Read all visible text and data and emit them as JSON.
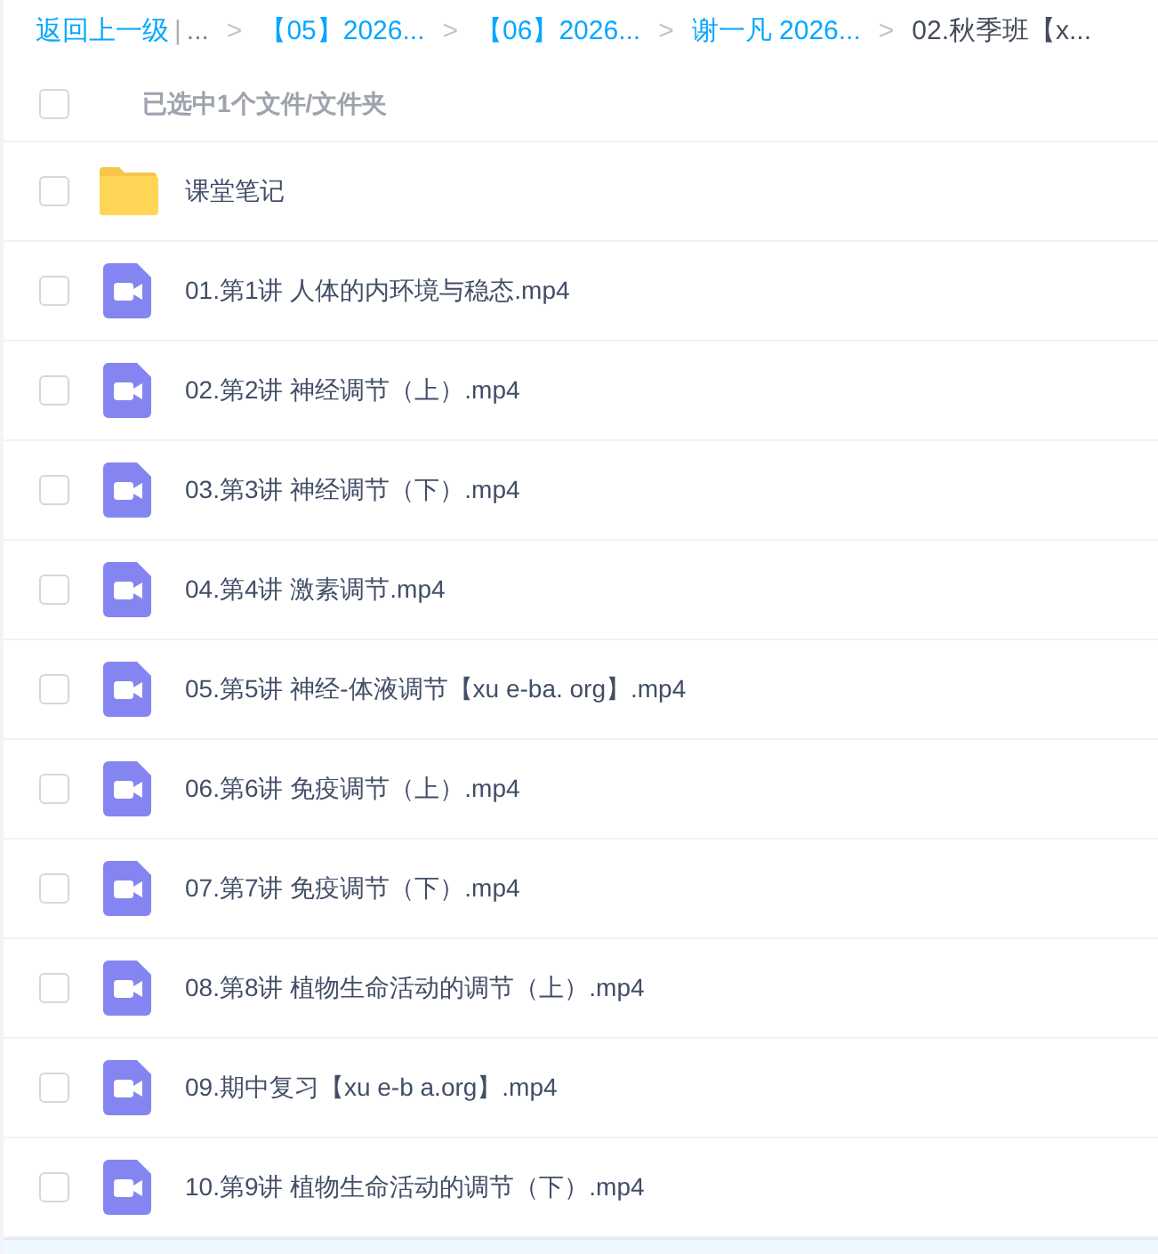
{
  "breadcrumb": {
    "back": "返回上一级",
    "divider": "|",
    "items": [
      {
        "label": "...",
        "current": false,
        "kind": "ellipsis"
      },
      {
        "label": "【05】2026...",
        "sep": ">",
        "current": false,
        "kind": "link"
      },
      {
        "label": "【06】2026...",
        "sep": ">",
        "current": false,
        "kind": "link"
      },
      {
        "label": "谢一凡 2026...",
        "sep": ">",
        "current": false,
        "kind": "link"
      },
      {
        "label": "02.秋季班【x...",
        "sep": ">",
        "current": true,
        "kind": "link"
      }
    ]
  },
  "header": {
    "checked": false,
    "selection_text": "已选中1个文件/文件夹"
  },
  "files": [
    {
      "name": "课堂笔记",
      "kind": "folder",
      "checked": false
    },
    {
      "name": "01.第1讲 人体的内环境与稳态.mp4",
      "kind": "video",
      "checked": false
    },
    {
      "name": "02.第2讲 神经调节（上）.mp4",
      "kind": "video",
      "checked": false
    },
    {
      "name": "03.第3讲 神经调节（下）.mp4",
      "kind": "video",
      "checked": false
    },
    {
      "name": "04.第4讲 激素调节.mp4",
      "kind": "video",
      "checked": false
    },
    {
      "name": "05.第5讲 神经-体液调节【xu e-ba. org】.mp4",
      "kind": "video",
      "checked": false
    },
    {
      "name": "06.第6讲 免疫调节（上）.mp4",
      "kind": "video",
      "checked": false
    },
    {
      "name": "07.第7讲 免疫调节（下）.mp4",
      "kind": "video",
      "checked": false
    },
    {
      "name": "08.第8讲 植物生命活动的调节（上）.mp4",
      "kind": "video",
      "checked": false
    },
    {
      "name": "09.期中复习【xu e-b a.org】.mp4",
      "kind": "video",
      "checked": false
    },
    {
      "name": "10.第9讲 植物生命活动的调节（下）.mp4",
      "kind": "video",
      "checked": false
    }
  ]
}
